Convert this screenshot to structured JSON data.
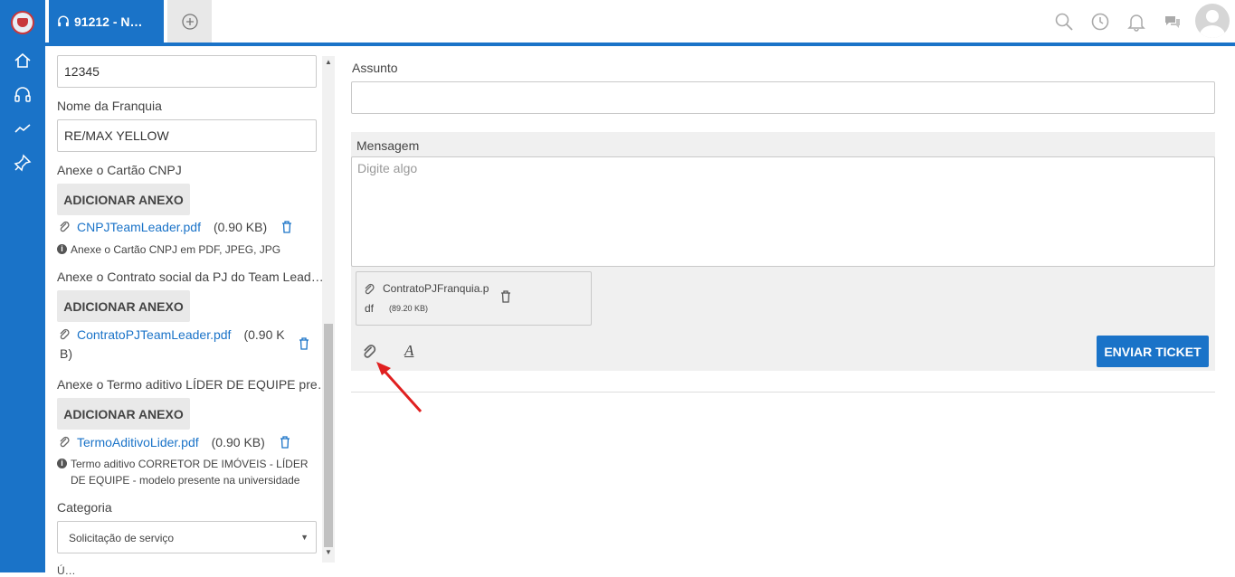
{
  "header": {
    "active_tab_label": "91212 - N…"
  },
  "left_form": {
    "code_value": "12345",
    "franchise_label": "Nome da Franquia",
    "franchise_value": "RE/MAX YELLOW",
    "cnpj_label": "Anexe o Cartão CNPJ",
    "cnpj_button": "ADICIONAR ANEXO",
    "cnpj_file": "CNPJTeamLeader.pdf",
    "cnpj_size": "(0.90 KB)",
    "cnpj_hint": "Anexe o Cartão CNPJ em PDF, JPEG, JPG",
    "contrato_label": "Anexe o Contrato social da PJ do Team Lead…",
    "contrato_button": "ADICIONAR ANEXO",
    "contrato_file": "ContratoPJTeamLeader.pdf",
    "contrato_size_a": "(0.90 K",
    "contrato_size_b": "B)",
    "termo_label": "Anexe o Termo aditivo LÍDER DE EQUIPE pre…",
    "termo_button": "ADICIONAR ANEXO",
    "termo_file": "TermoAditivoLider.pdf",
    "termo_size": "(0.90 KB)",
    "termo_hint": "Termo aditivo CORRETOR DE IMÓVEIS - LÍDER DE EQUIPE - modelo presente na universidade",
    "categoria_label": "Categoria",
    "categoria_value": "Solicitação de serviço",
    "bottom_cut_label": "Ú…"
  },
  "main": {
    "assunto_label": "Assunto",
    "assunto_value": "",
    "mensagem_label": "Mensagem",
    "mensagem_placeholder": "Digite algo",
    "attachment_name_a": "ContratoPJFranquia.p",
    "attachment_name_b": "df",
    "attachment_size": "(89.20 KB)",
    "send_button": "ENVIAR TICKET",
    "format_icon_glyph": "A"
  },
  "colors": {
    "brand_blue": "#1a73c8",
    "arrow_red": "#e02020"
  }
}
